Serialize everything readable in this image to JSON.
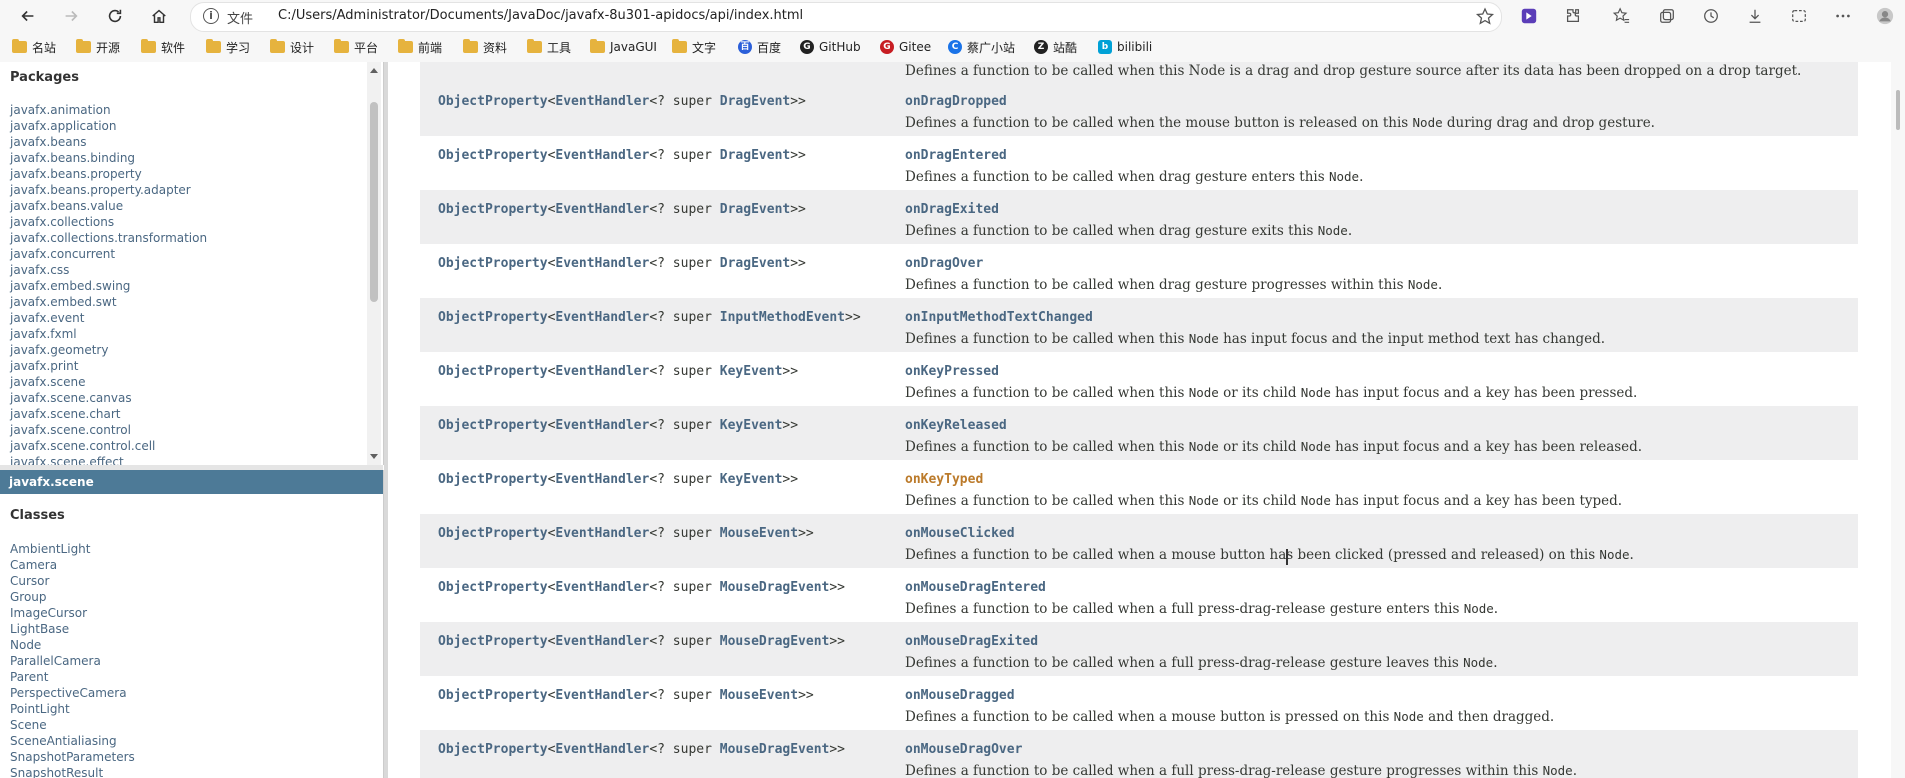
{
  "browser": {
    "scheme_label": "文件",
    "url": "C:/Users/Administrator/Documents/JavaDoc/javafx-8u301-apidocs/api/index.html"
  },
  "bookmarks": [
    {
      "label": "名站",
      "icon": "folder-icon"
    },
    {
      "label": "开源",
      "icon": "folder-icon"
    },
    {
      "label": "软件",
      "icon": "folder-icon"
    },
    {
      "label": "学习",
      "icon": "folder-icon"
    },
    {
      "label": "设计",
      "icon": "folder-icon"
    },
    {
      "label": "平台",
      "icon": "folder-icon"
    },
    {
      "label": "前端",
      "icon": "folder-icon"
    },
    {
      "label": "资料",
      "icon": "folder-icon"
    },
    {
      "label": "工具",
      "icon": "folder-icon"
    },
    {
      "label": "JavaGUI",
      "icon": "folder-icon"
    },
    {
      "label": "文字",
      "icon": "folder-icon"
    },
    {
      "label": "百度",
      "icon": "baidu-icon"
    },
    {
      "label": "GitHub",
      "icon": "github-icon"
    },
    {
      "label": "Gitee",
      "icon": "gitee-icon"
    },
    {
      "label": "蔡广小站",
      "icon": "site-icon"
    },
    {
      "label": "站酷",
      "icon": "zcool-icon"
    },
    {
      "label": "bilibili",
      "icon": "bilibili-icon"
    }
  ],
  "packages": {
    "title": "Packages",
    "items": [
      "javafx.animation",
      "javafx.application",
      "javafx.beans",
      "javafx.beans.binding",
      "javafx.beans.property",
      "javafx.beans.property.adapter",
      "javafx.beans.value",
      "javafx.collections",
      "javafx.collections.transformation",
      "javafx.concurrent",
      "javafx.css",
      "javafx.embed.swing",
      "javafx.embed.swt",
      "javafx.event",
      "javafx.fxml",
      "javafx.geometry",
      "javafx.print",
      "javafx.scene",
      "javafx.scene.canvas",
      "javafx.scene.chart",
      "javafx.scene.control",
      "javafx.scene.control.cell",
      "javafx.scene.effect"
    ]
  },
  "current_package": "javafx.scene",
  "classes": {
    "title": "Classes",
    "items": [
      "AmbientLight",
      "Camera",
      "Cursor",
      "Group",
      "ImageCursor",
      "LightBase",
      "Node",
      "ParallelCamera",
      "Parent",
      "PerspectiveCamera",
      "PointLight",
      "Scene",
      "SceneAntialiasing",
      "SnapshotParameters",
      "SnapshotResult"
    ]
  },
  "main": {
    "prev_desc": "Defines a function to be called when this Node is a drag and drop gesture source after its data has been dropped on a drop target.",
    "type_prefix": "ObjectProperty",
    "type_mid": "<",
    "type_handler": "EventHandler",
    "type_super": "<? super ",
    "type_suffix": ">>",
    "rows": [
      {
        "event": "DragEvent",
        "member": "onDragDropped",
        "desc": [
          "Defines a function to be called when the mouse button is released on this ",
          "Node",
          " during drag and drop gesture."
        ]
      },
      {
        "event": "DragEvent",
        "member": "onDragEntered",
        "desc": [
          "Defines a function to be called when drag gesture enters this ",
          "Node",
          "."
        ]
      },
      {
        "event": "DragEvent",
        "member": "onDragExited",
        "desc": [
          "Defines a function to be called when drag gesture exits this ",
          "Node",
          "."
        ]
      },
      {
        "event": "DragEvent",
        "member": "onDragOver",
        "desc": [
          "Defines a function to be called when drag gesture progresses within this ",
          "Node",
          "."
        ]
      },
      {
        "event": "InputMethodEvent",
        "member": "onInputMethodTextChanged",
        "desc": [
          "Defines a function to be called when this ",
          "Node",
          " has input focus and the input method text has changed."
        ]
      },
      {
        "event": "KeyEvent",
        "member": "onKeyPressed",
        "desc": [
          "Defines a function to be called when this ",
          "Node",
          " or its child ",
          "Node",
          " has input focus and a key has been pressed."
        ]
      },
      {
        "event": "KeyEvent",
        "member": "onKeyReleased",
        "desc": [
          "Defines a function to be called when this ",
          "Node",
          " or its child ",
          "Node",
          " has input focus and a key has been released."
        ]
      },
      {
        "event": "KeyEvent",
        "member": "onKeyTyped",
        "desc": [
          "Defines a function to be called when this ",
          "Node",
          " or its child ",
          "Node",
          " has input focus and a key has been typed."
        ]
      },
      {
        "event": "MouseEvent",
        "member": "onMouseClicked",
        "desc": [
          "Defines a function to be called when a mouse button has been clicked (pressed and released) on this ",
          "Node",
          "."
        ]
      },
      {
        "event": "MouseDragEvent",
        "member": "onMouseDragEntered",
        "desc": [
          "Defines a function to be called when a full press-drag-release gesture enters this ",
          "Node",
          "."
        ]
      },
      {
        "event": "MouseDragEvent",
        "member": "onMouseDragExited",
        "desc": [
          "Defines a function to be called when a full press-drag-release gesture leaves this ",
          "Node",
          "."
        ]
      },
      {
        "event": "MouseEvent",
        "member": "onMouseDragged",
        "desc": [
          "Defines a function to be called when a mouse button is pressed on this ",
          "Node",
          " and then dragged."
        ]
      },
      {
        "event": "MouseDragEvent",
        "member": "onMouseDragOver",
        "desc": [
          "Defines a function to be called when a full press-drag-release gesture progresses within this ",
          "Node",
          "."
        ]
      }
    ]
  }
}
